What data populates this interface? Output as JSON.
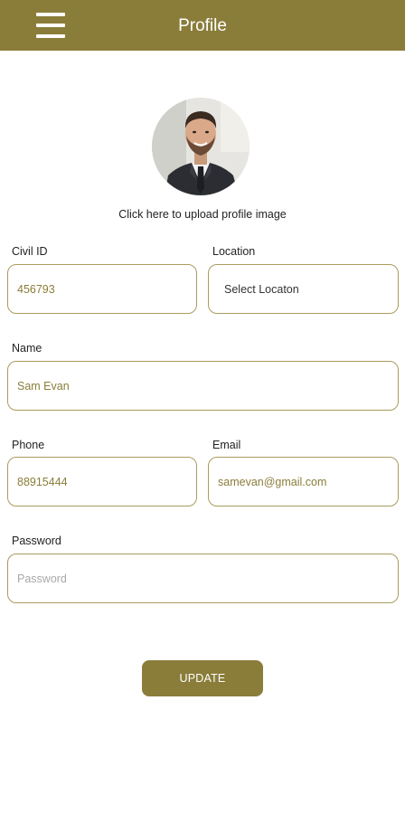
{
  "header": {
    "title": "Profile",
    "menu_icon": "hamburger-menu-icon",
    "background_color": "#8a7d3a"
  },
  "profile": {
    "upload_caption": "Click here to upload profile image"
  },
  "form": {
    "civil_id": {
      "label": "Civil ID",
      "value": "456793"
    },
    "location": {
      "label": "Location",
      "value": "Select Locaton"
    },
    "name": {
      "label": "Name",
      "value": "Sam Evan"
    },
    "phone": {
      "label": "Phone",
      "value": "88915444"
    },
    "email": {
      "label": "Email",
      "value": "samevan@gmail.com"
    },
    "password": {
      "label": "Password",
      "value": "",
      "placeholder": "Password"
    }
  },
  "actions": {
    "update_label": "UPDATE"
  },
  "colors": {
    "accent": "#8a7d3a",
    "field_border": "#a89c5e",
    "field_text": "#8a7d3a"
  }
}
